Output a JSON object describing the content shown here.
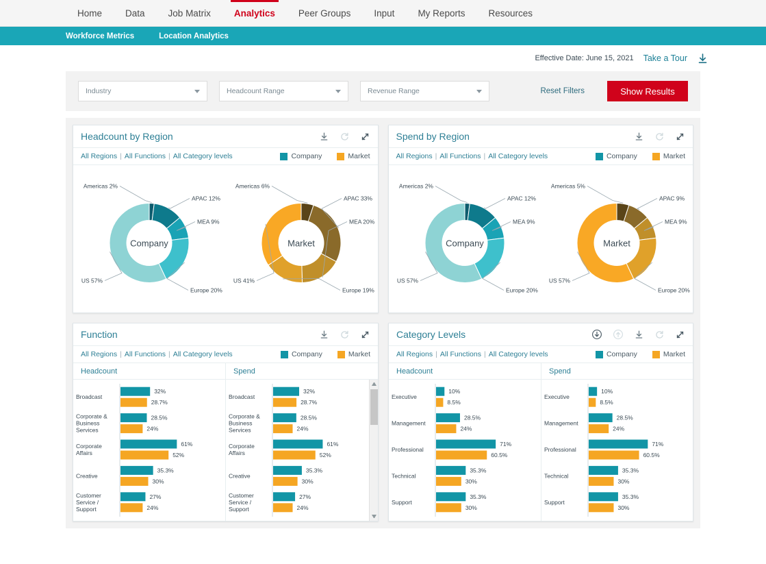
{
  "topnav": {
    "items": [
      {
        "label": "Home",
        "active": false
      },
      {
        "label": "Data",
        "active": false
      },
      {
        "label": "Job Matrix",
        "active": false
      },
      {
        "label": "Analytics",
        "active": true
      },
      {
        "label": "Peer Groups",
        "active": false
      },
      {
        "label": "Input",
        "active": false
      },
      {
        "label": "My Reports",
        "active": false
      },
      {
        "label": "Resources",
        "active": false
      }
    ]
  },
  "subnav": {
    "items": [
      {
        "label": "Workforce Metrics"
      },
      {
        "label": "Location Analytics"
      }
    ]
  },
  "meta": {
    "effective_date": "Effective Date: June 15, 2021",
    "take_a_tour": "Take a Tour",
    "download_icon": "download-icon"
  },
  "filters": {
    "industry": {
      "value": "Industry",
      "placeholder": "Industry"
    },
    "headcount_range": {
      "value": "Headcount Range",
      "placeholder": "Headcount Range"
    },
    "revenue_range": {
      "value": "Revenue Range",
      "placeholder": "Revenue Range"
    },
    "reset_label": "Reset Filters",
    "show_results_label": "Show Results"
  },
  "legend": {
    "company": "Company",
    "market": "Market",
    "company_color": "#1295a6",
    "market_color": "#f5a623"
  },
  "breadcrumb": {
    "all_regions": "All Regions",
    "all_functions": "All Functions",
    "all_category_levels": "All Category levels",
    "separator": "|"
  },
  "panels": {
    "headcount_by_region": {
      "title": "Headcount by Region",
      "icons": [
        "download-icon",
        "refresh-icon",
        "expand-icon"
      ]
    },
    "spend_by_region": {
      "title": "Spend by Region",
      "icons": [
        "download-icon",
        "refresh-icon",
        "expand-icon"
      ]
    },
    "function": {
      "title": "Function",
      "icons": [
        "download-icon",
        "refresh-icon",
        "expand-icon"
      ],
      "col_headcount": "Headcount",
      "col_spend": "Spend"
    },
    "category_levels": {
      "title": "Category Levels",
      "icons": [
        "drill-down-icon",
        "drill-up-icon",
        "download-icon",
        "refresh-icon",
        "expand-icon"
      ],
      "col_headcount": "Headcount",
      "col_spend": "Spend"
    }
  },
  "chart_data": [
    {
      "type": "pie",
      "title": "Headcount by Region — Company",
      "center_label": "Company",
      "labels": [
        "Americas",
        "APAC",
        "MEA",
        "Europe",
        "US"
      ],
      "values": [
        2,
        12,
        9,
        20,
        57
      ],
      "value_labels": [
        "Americas 2%",
        "APAC 12%",
        "MEA 9%",
        "Europe 20%",
        "US 57%"
      ],
      "colors": [
        "#0d5c6e",
        "#0e7a8c",
        "#1aa3b5",
        "#3ec0cc",
        "#8ed3d4"
      ]
    },
    {
      "type": "pie",
      "title": "Headcount by Region — Market",
      "center_label": "Market",
      "labels": [
        "Americas",
        "APAC",
        "MEA",
        "Europe",
        "US"
      ],
      "values": [
        6,
        33,
        20,
        19,
        41
      ],
      "value_labels": [
        "Americas 6%",
        "APAC 33%",
        "MEA 20%",
        "Europe 19%",
        "US 41%"
      ],
      "colors": [
        "#5a4418",
        "#8a6a2a",
        "#c08f2a",
        "#e0a12a",
        "#f9a825"
      ]
    },
    {
      "type": "pie",
      "title": "Spend by Region — Company",
      "center_label": "Company",
      "labels": [
        "Americas",
        "APAC",
        "MEA",
        "Europe",
        "US"
      ],
      "values": [
        2,
        12,
        9,
        20,
        57
      ],
      "value_labels": [
        "Americas 2%",
        "APAC 12%",
        "MEA 9%",
        "Europe 20%",
        "US 57%"
      ],
      "colors": [
        "#0d5c6e",
        "#0e7a8c",
        "#1aa3b5",
        "#3ec0cc",
        "#8ed3d4"
      ]
    },
    {
      "type": "pie",
      "title": "Spend by Region — Market",
      "center_label": "Market",
      "labels": [
        "Americas",
        "APAC",
        "MEA",
        "Europe",
        "US"
      ],
      "values": [
        5,
        9,
        9,
        20,
        57
      ],
      "value_labels": [
        "Americas 5%",
        "APAC 9%",
        "MEA 9%",
        "Europe 20%",
        "US 57%"
      ],
      "colors": [
        "#5a4418",
        "#8a6a2a",
        "#c08f2a",
        "#e0a12a",
        "#f9a825"
      ]
    },
    {
      "type": "bar",
      "title": "Function — Headcount",
      "orientation": "horizontal",
      "categories": [
        "Broadcast",
        "Corporate & Business Services",
        "Corporate Affairs",
        "Creative",
        "Customer Service / Support"
      ],
      "series": [
        {
          "name": "Company",
          "color": "#1295a6",
          "values": [
            32,
            28.5,
            61,
            35.3,
            27
          ],
          "value_labels": [
            "32%",
            "28.5%",
            "61%",
            "35.3%",
            "27%"
          ]
        },
        {
          "name": "Market",
          "color": "#f5a623",
          "values": [
            28.7,
            24,
            52,
            30,
            24
          ],
          "value_labels": [
            "28.7%",
            "24%",
            "52%",
            "30%",
            "24%"
          ]
        }
      ],
      "xlim": [
        0,
        80
      ]
    },
    {
      "type": "bar",
      "title": "Function — Spend",
      "orientation": "horizontal",
      "categories": [
        "Broadcast",
        "Corporate & Business Services",
        "Corporate Affairs",
        "Creative",
        "Customer Service / Support"
      ],
      "series": [
        {
          "name": "Company",
          "color": "#1295a6",
          "values": [
            32,
            28.5,
            61,
            35.3,
            27
          ],
          "value_labels": [
            "32%",
            "28.5%",
            "61%",
            "35.3%",
            "27%"
          ]
        },
        {
          "name": "Market",
          "color": "#f5a623",
          "values": [
            28.7,
            24,
            52,
            30,
            24
          ],
          "value_labels": [
            "28.7%",
            "24%",
            "52%",
            "30%",
            "24%"
          ]
        }
      ],
      "xlim": [
        0,
        80
      ]
    },
    {
      "type": "bar",
      "title": "Category Levels — Headcount",
      "orientation": "horizontal",
      "categories": [
        "Executive",
        "Management",
        "Professional",
        "Technical",
        "Support"
      ],
      "series": [
        {
          "name": "Company",
          "color": "#1295a6",
          "values": [
            10,
            28.5,
            71,
            35.3,
            35.3
          ],
          "value_labels": [
            "10%",
            "28.5%",
            "71%",
            "35.3%",
            "35.3%"
          ]
        },
        {
          "name": "Market",
          "color": "#f5a623",
          "values": [
            8.5,
            24,
            60.5,
            30,
            30
          ],
          "value_labels": [
            "8.5%",
            "24%",
            "60.5%",
            "30%",
            "30%"
          ]
        }
      ],
      "xlim": [
        0,
        88
      ]
    },
    {
      "type": "bar",
      "title": "Category Levels — Spend",
      "orientation": "horizontal",
      "categories": [
        "Executive",
        "Management",
        "Professional",
        "Technical",
        "Support"
      ],
      "series": [
        {
          "name": "Company",
          "color": "#1295a6",
          "values": [
            10,
            28.5,
            71,
            35.3,
            35.3
          ],
          "value_labels": [
            "10%",
            "28.5%",
            "71%",
            "35.3%",
            "35.3%"
          ]
        },
        {
          "name": "Market",
          "color": "#f5a623",
          "values": [
            8.5,
            24,
            60.5,
            30,
            30
          ],
          "value_labels": [
            "8.5%",
            "24%",
            "60.5%",
            "30%",
            "30%"
          ]
        }
      ],
      "xlim": [
        0,
        88
      ]
    }
  ]
}
